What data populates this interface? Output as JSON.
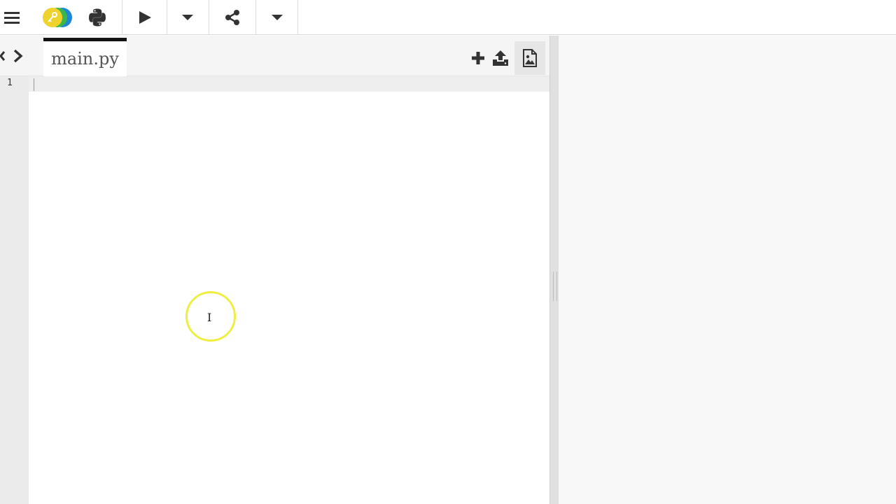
{
  "toolbar": {
    "items": [
      "menu-icon",
      "logo-icon",
      "python-icon",
      "run-icon",
      "run-options-icon",
      "share-icon",
      "share-options-icon"
    ]
  },
  "editor": {
    "tabs": [
      {
        "label": "main.py"
      }
    ],
    "line_numbers": [
      "1"
    ],
    "actions": [
      "add-file-icon",
      "upload-icon",
      "image-icon"
    ]
  },
  "colors": {
    "logo_yellow": "#f0d22e",
    "logo_green": "#3cb84a",
    "logo_blue": "#1f86d6",
    "icon_dark": "#333333",
    "tab_border": "#111111",
    "highlight_ring": "#eeee44"
  }
}
